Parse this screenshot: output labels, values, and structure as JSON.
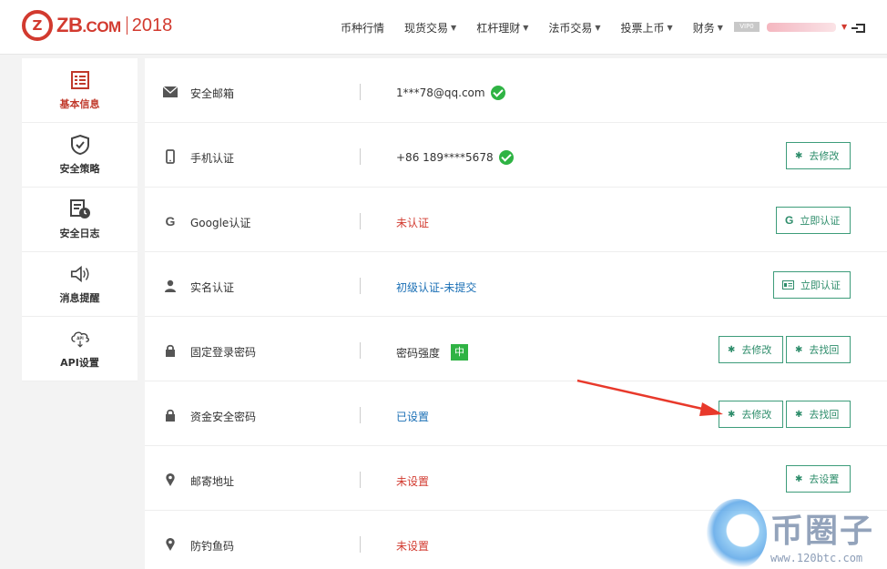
{
  "header": {
    "logo": {
      "mark": "Z",
      "name": "ZB",
      "suffix": ".COM",
      "year": "2018"
    },
    "nav": [
      "币种行情",
      "现货交易",
      "杠杆理财",
      "法币交易",
      "投票上币",
      "财务"
    ],
    "nav_has_caret": [
      false,
      true,
      true,
      true,
      true,
      true
    ],
    "vip": "VIP0"
  },
  "sidebar": {
    "items": [
      {
        "label": "基本信息",
        "icon": "profile-icon",
        "active": true
      },
      {
        "label": "安全策略",
        "icon": "shield-icon",
        "active": false
      },
      {
        "label": "安全日志",
        "icon": "log-clock-icon",
        "active": false
      },
      {
        "label": "消息提醒",
        "icon": "speaker-icon",
        "active": false
      },
      {
        "label": "API设置",
        "icon": "cloud-api-icon",
        "active": false
      }
    ]
  },
  "rows": [
    {
      "label": "安全邮箱",
      "icon": "mail-icon",
      "value": "1***78@qq.com",
      "verified": true,
      "style": "normal",
      "buttons": []
    },
    {
      "label": "手机认证",
      "icon": "phone-icon",
      "value": "+86 189****5678",
      "verified": true,
      "style": "normal",
      "buttons": [
        "去修改"
      ]
    },
    {
      "label": "Google认证",
      "icon": "google-icon",
      "value": "未认证",
      "verified": false,
      "style": "red",
      "buttons": [
        "立即认证"
      ]
    },
    {
      "label": "实名认证",
      "icon": "user-icon",
      "value": "初级认证-未提交",
      "verified": false,
      "style": "blue",
      "buttons": [
        "立即认证"
      ]
    },
    {
      "label": "固定登录密码",
      "icon": "lock-icon",
      "value": "密码强度",
      "strength": "中",
      "style": "normal",
      "buttons": [
        "去修改",
        "去找回"
      ]
    },
    {
      "label": "资金安全密码",
      "icon": "lock-icon",
      "value": "已设置",
      "style": "blue",
      "buttons": [
        "去修改",
        "去找回"
      ]
    },
    {
      "label": "邮寄地址",
      "icon": "pin-icon",
      "value": "未设置",
      "style": "red",
      "buttons": [
        "去设置"
      ]
    },
    {
      "label": "防钓鱼码",
      "icon": "pin-icon",
      "value": "未设置",
      "style": "red",
      "buttons": []
    }
  ],
  "watermark": {
    "title": "币圈子",
    "url": "www.120btc.com"
  },
  "colors": {
    "brand": "#d23a2f",
    "success": "#2fb344",
    "button": "#2e8d6b",
    "link": "#1a6fb5",
    "arrow": "#e8392b"
  }
}
